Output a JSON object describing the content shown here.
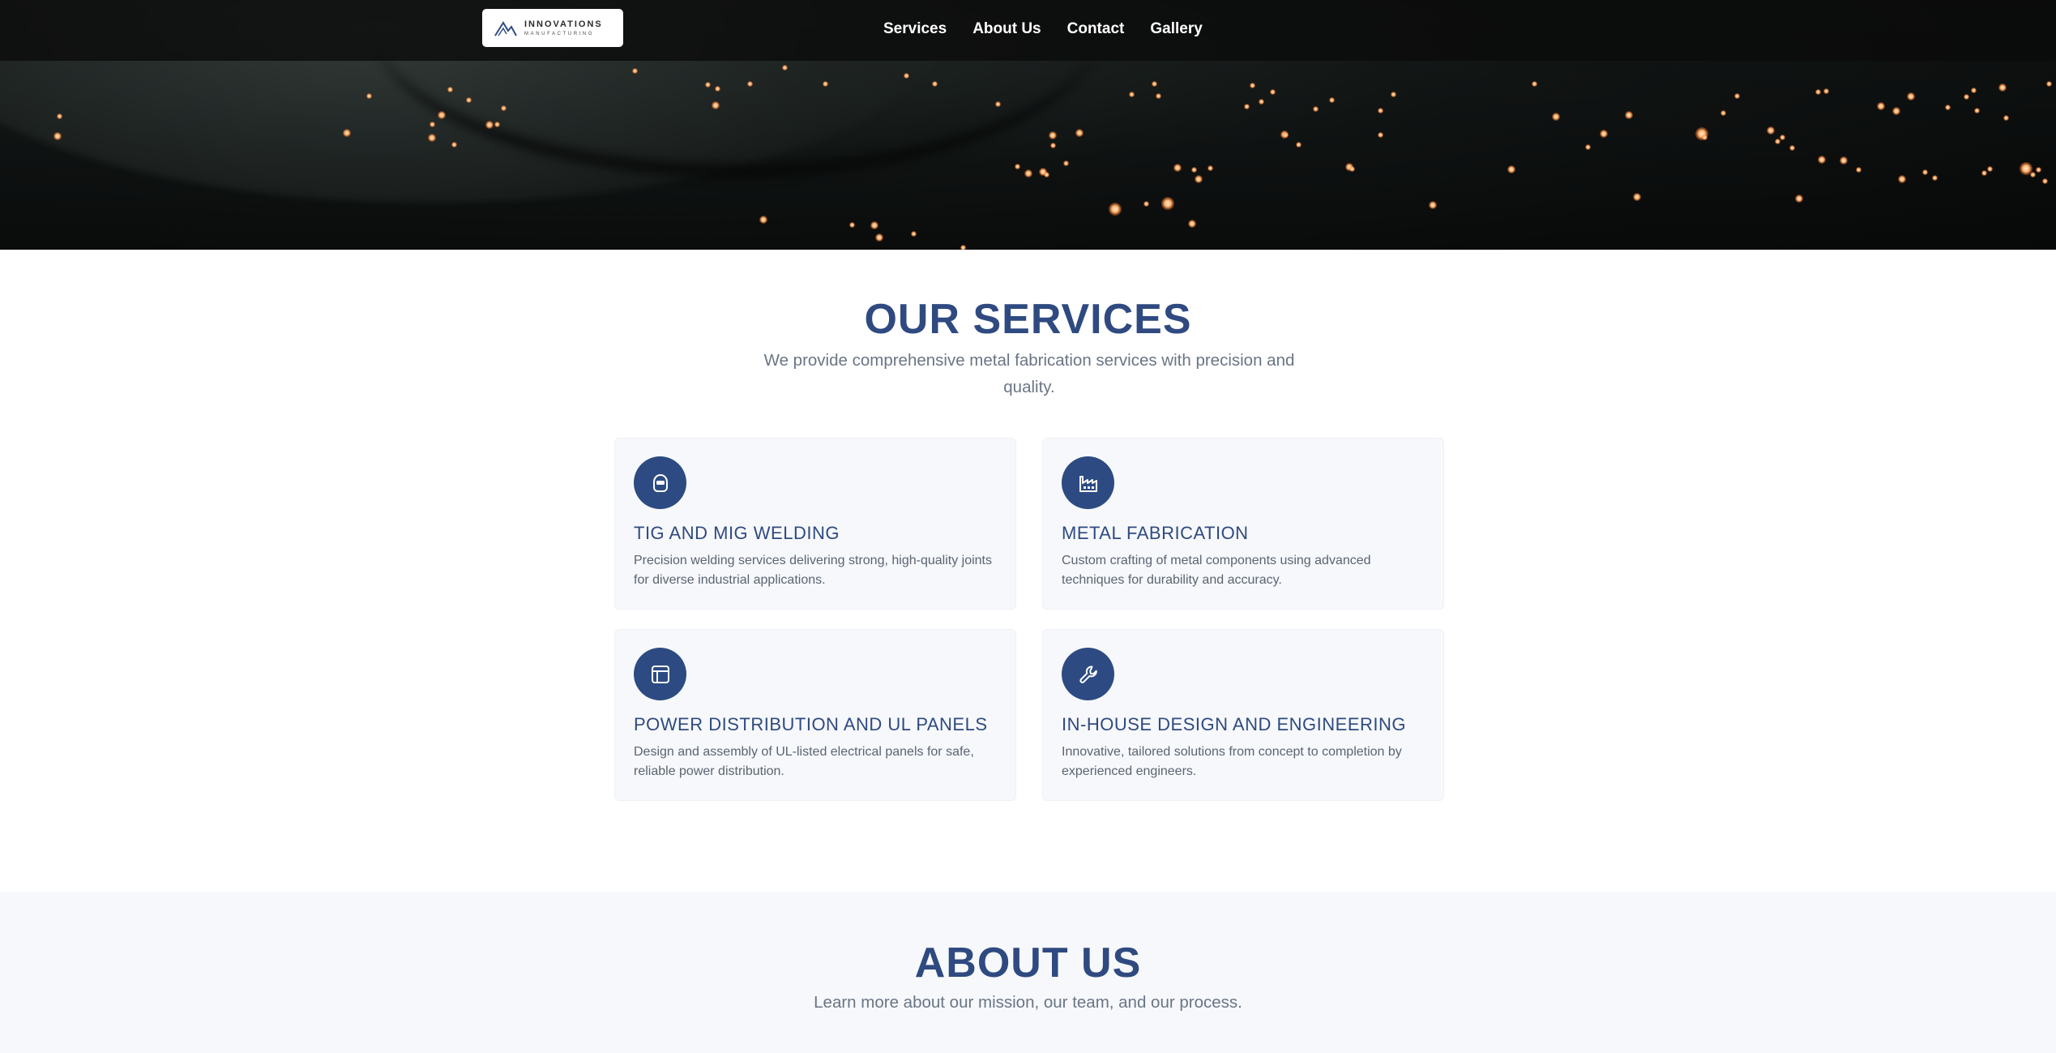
{
  "logo": {
    "line1": "INNOVATIONS",
    "line2": "MANUFACTURING"
  },
  "nav": {
    "items": [
      "Services",
      "About Us",
      "Contact",
      "Gallery"
    ]
  },
  "services": {
    "title": "OUR SERVICES",
    "subtitle": "We provide comprehensive metal fabrication services with precision and quality.",
    "cards": [
      {
        "icon": "welding-helmet-icon",
        "title": "TIG AND MIG WELDING",
        "description": "Precision welding services delivering strong, high-quality joints for diverse industrial applications."
      },
      {
        "icon": "factory-icon",
        "title": "METAL FABRICATION",
        "description": "Custom crafting of metal components using advanced techniques for durability and accuracy."
      },
      {
        "icon": "panel-layout-icon",
        "title": "POWER DISTRIBUTION AND UL PANELS",
        "description": "Design and assembly of UL-listed electrical panels for safe, reliable power distribution."
      },
      {
        "icon": "wrench-icon",
        "title": "IN-HOUSE DESIGN AND ENGINEERING",
        "description": "Innovative, tailored solutions from concept to completion by experienced engineers."
      }
    ]
  },
  "about": {
    "title": "ABOUT US",
    "subtitle": "Learn more about our mission, our team, and our process."
  },
  "colors": {
    "primary": "#2f4a80",
    "icon_circle": "#2d4b82",
    "card_bg": "#f6f8fb",
    "nav_bg": "#0a0a0a"
  }
}
